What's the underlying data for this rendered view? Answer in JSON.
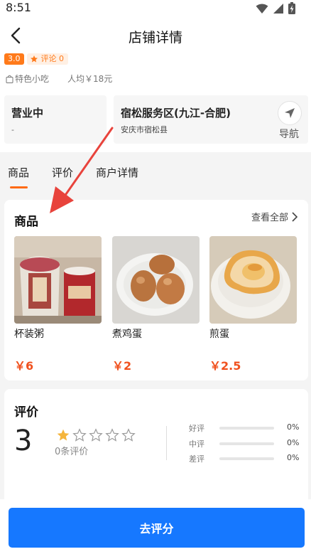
{
  "status_bar": {
    "time": "8:51"
  },
  "nav": {
    "title": "店铺详情"
  },
  "store": {
    "score": "3.0",
    "reviews_label": "评论 0",
    "category": "特色小吃",
    "avg_price": "人均￥18元"
  },
  "hours": {
    "status": "营业中",
    "time": "-"
  },
  "address": {
    "name": "宿松服务区(九江-合肥)",
    "detail": "安庆市宿松县",
    "nav_label": "导航"
  },
  "tabs": [
    {
      "label": "商品"
    },
    {
      "label": "评价"
    },
    {
      "label": "商户详情"
    }
  ],
  "goods": {
    "title": "商品",
    "view_all": "查看全部",
    "items": [
      {
        "name": "杯装粥",
        "price": "￥6"
      },
      {
        "name": "煮鸡蛋",
        "price": "￥2"
      },
      {
        "name": "煎蛋",
        "price": "￥2.5"
      }
    ]
  },
  "reviews": {
    "title": "评价",
    "score": "3",
    "stars_filled": 1,
    "stars_total": 5,
    "count": "0条评价",
    "distribution": [
      {
        "label": "好评",
        "pct": "0%",
        "value": 0
      },
      {
        "label": "中评",
        "pct": "0%",
        "value": 0
      },
      {
        "label": "差评",
        "pct": "0%",
        "value": 0
      }
    ]
  },
  "bottom": {
    "button_label": "去评分"
  },
  "colors": {
    "accent": "#ff6a13",
    "primary_button": "#1678ff",
    "price": "#f0511e",
    "annotation_arrow": "#e8433c"
  }
}
